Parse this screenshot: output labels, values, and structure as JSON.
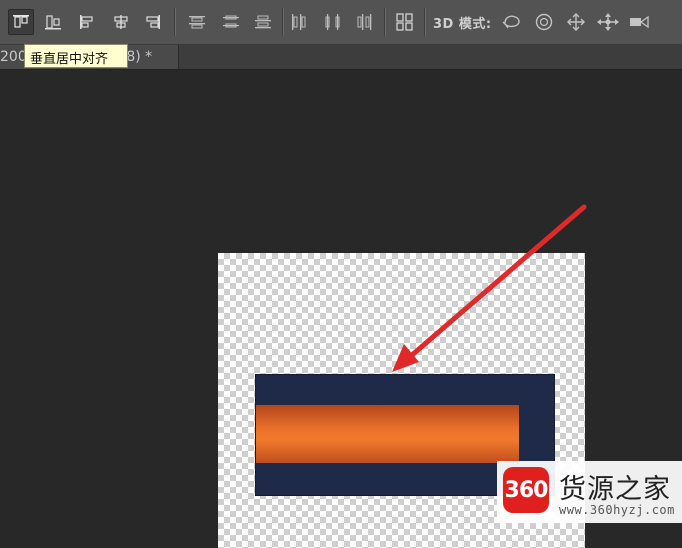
{
  "options_bar": {
    "tools": [
      {
        "name": "align-top-edges-icon",
        "active": true
      },
      {
        "name": "align-vertical-centers-icon",
        "active": false
      },
      {
        "name": "align-bottom-edges-icon",
        "active": false
      },
      {
        "name": "align-left-edges-icon",
        "active": false
      },
      {
        "name": "align-horizontal-centers-icon",
        "active": false
      },
      {
        "name": "align-right-edges-icon",
        "active": false
      },
      {
        "name": "distribute-top-edges-icon",
        "active": false
      },
      {
        "name": "distribute-vertical-centers-icon",
        "active": false
      },
      {
        "name": "distribute-bottom-edges-icon",
        "active": false
      },
      {
        "name": "distribute-left-edges-icon",
        "active": false
      },
      {
        "name": "distribute-horizontal-centers-icon",
        "active": false
      },
      {
        "name": "distribute-right-edges-icon",
        "active": false
      },
      {
        "name": "auto-align-layers-icon",
        "active": false
      }
    ],
    "mode_label": "3D 模式:",
    "mode_tools": [
      "rotate-3d-icon",
      "roll-3d-icon",
      "drag-3d-icon",
      "slide-3d-icon",
      "scale-3d-icon"
    ]
  },
  "tooltip": {
    "text": "垂直居中对齐"
  },
  "document_tab": {
    "title_prefix": "200",
    "title_suffix": "3/8) *"
  },
  "canvas": {
    "colors": {
      "background": "#282828",
      "navy_rect": "#1e2a47",
      "orange_bar": "#f07a2c",
      "arrow": "#e02a2a"
    }
  },
  "watermark": {
    "badge": "360",
    "name": "货源之家",
    "url": "www.360hyzj.com"
  }
}
